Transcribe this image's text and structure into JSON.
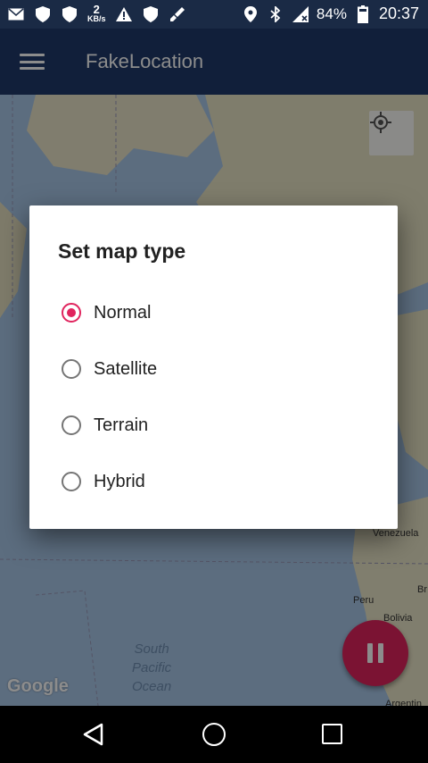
{
  "status_bar": {
    "speed_value": "2",
    "speed_unit": "KB/s",
    "battery": "84%",
    "time": "20:37",
    "icons": [
      "mail-icon",
      "shield-icon",
      "shield-icon",
      "speed-indicator",
      "warning-icon",
      "shield-icon",
      "brush-icon",
      "location-pin-icon",
      "bluetooth-icon",
      "signal-icon",
      "battery-icon"
    ]
  },
  "app_bar": {
    "title": "FakeLocation"
  },
  "map": {
    "ocean_label": [
      "South",
      "Pacific",
      "Ocean"
    ],
    "places": [
      "Venezuela",
      "Peru",
      "Br",
      "Bolivia",
      "Argentin"
    ],
    "attribution": "Google"
  },
  "dialog": {
    "title": "Set map type",
    "options": [
      {
        "label": "Normal",
        "checked": true
      },
      {
        "label": "Satellite",
        "checked": false
      },
      {
        "label": "Terrain",
        "checked": false
      },
      {
        "label": "Hybrid",
        "checked": false
      }
    ]
  },
  "colors": {
    "accent": "#e0245e",
    "app_bar": "#1f3a6b",
    "status_bar": "#1a2a45"
  }
}
